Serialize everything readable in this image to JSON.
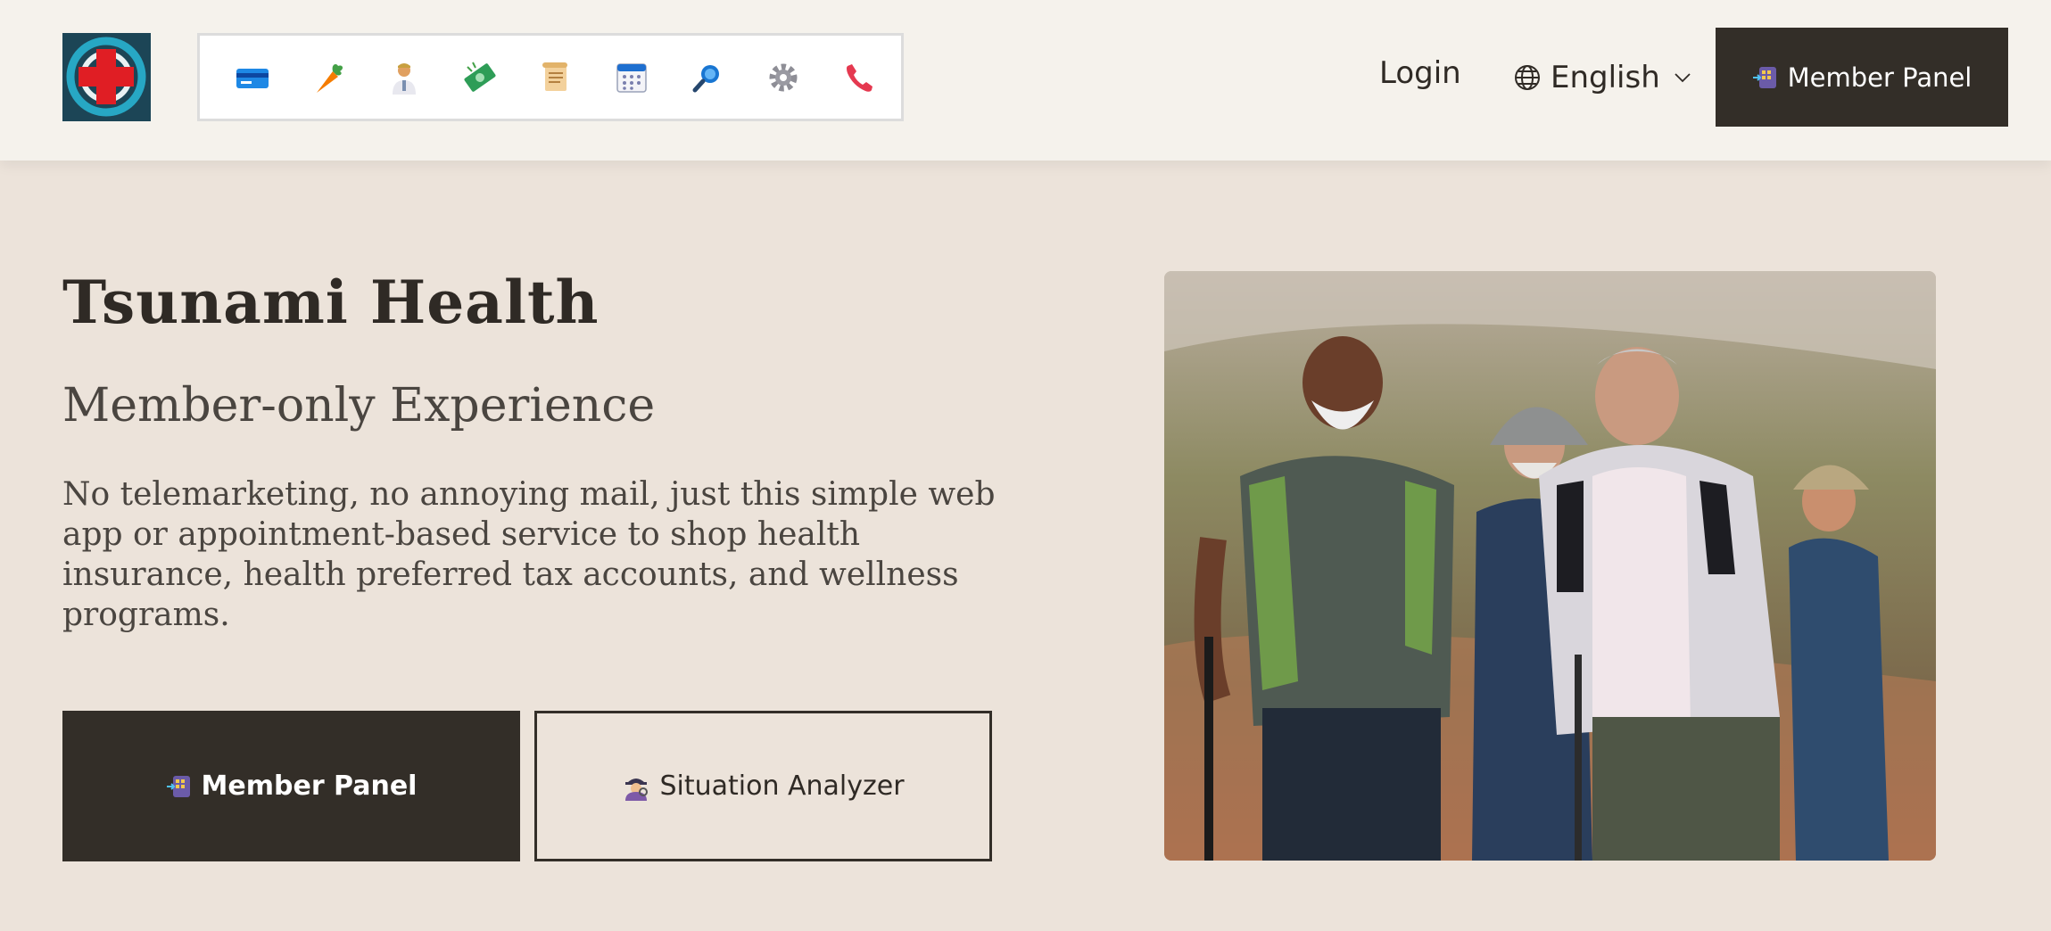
{
  "header": {
    "login_label": "Login",
    "language_label": "English",
    "member_panel_label": "Member Panel",
    "toolbar_icons": [
      "credit-card-icon",
      "carrot-icon",
      "doctor-icon",
      "money-icon",
      "scroll-icon",
      "calendar-icon",
      "search-icon",
      "gear-icon",
      "phone-icon"
    ]
  },
  "hero": {
    "title": "Tsunami Health",
    "subtitle": "Member-only Experience",
    "description": "No telemarketing, no annoying mail, just this simple web app or appointment-based service to shop health insurance, health preferred tax accounts, and wellness programs.",
    "member_panel_label": "Member Panel",
    "situation_analyzer_label": "Situation Analyzer"
  },
  "colors": {
    "page_bg": "#ece3da",
    "header_bg": "#f5f2ec",
    "button_dark": "#332e28",
    "text_primary": "#2f2a25"
  }
}
